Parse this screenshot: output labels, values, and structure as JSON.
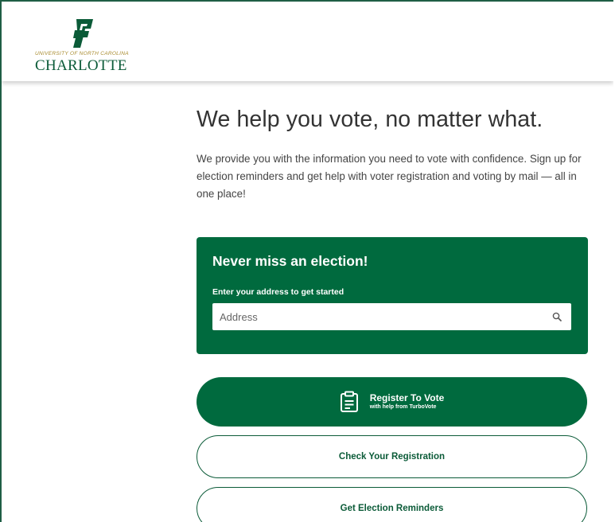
{
  "header": {
    "logo": {
      "subtitle": "UNIVERSITY OF NORTH CAROLINA",
      "name": "CHARLOTTE"
    }
  },
  "main": {
    "title": "We help you vote, no matter what.",
    "intro": "We provide you with the information you need to vote with confidence. Sign up for election reminders and get help with voter registration and voting by mail — all in one place!"
  },
  "signup_card": {
    "title": "Never miss an election!",
    "label": "Enter your address to get started",
    "address_placeholder": "Address",
    "address_value": "",
    "search_icon": "search-icon"
  },
  "actions": {
    "register": {
      "label": "Register To Vote",
      "sublabel": "with help from TurboVote",
      "icon": "clipboard-icon"
    },
    "check_registration": {
      "label": "Check Your Registration"
    },
    "election_reminders": {
      "label": "Get Election Reminders"
    }
  },
  "colors": {
    "brand_green": "#006a3e",
    "brand_gold": "#a88b2e",
    "frame_border": "#1f5e45"
  }
}
